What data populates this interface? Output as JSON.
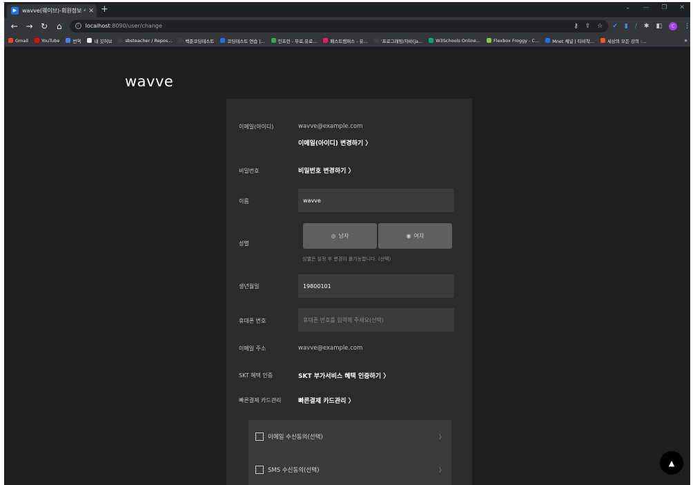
{
  "browser": {
    "tab_title": "wavve(웨이브)-회원정보 수정",
    "tab_close": "×",
    "new_tab": "+",
    "url_host": "localhost",
    "url_path": ":8090/user/change",
    "bookmarks": [
      {
        "label": "Gmail",
        "color": "#ea4335"
      },
      {
        "label": "YouTube",
        "color": "#ff0000"
      },
      {
        "label": "번역",
        "color": "#4285f4"
      },
      {
        "label": "내 깃허브",
        "color": "#e8eaed"
      },
      {
        "label": "sbsteacher / Repos...",
        "color": "#3c4043"
      },
      {
        "label": "백준코딩테스트",
        "color": "#3c4043"
      },
      {
        "label": "코딩테스트 연습 |...",
        "color": "#1a73e8"
      },
      {
        "label": "인프런 - 무료,유료...",
        "color": "#34a853"
      },
      {
        "label": "패스트캠퍼스 - 유...",
        "color": "#e91e63"
      },
      {
        "label": "'프로그래밍/자바(ja...",
        "color": "#3c4043"
      },
      {
        "label": "W3Schools Online...",
        "color": "#04aa6d"
      },
      {
        "label": "Flexbox Froggy - C...",
        "color": "#8bc34a"
      },
      {
        "label": "Mnet 채널 | 티비착...",
        "color": "#1a73e8"
      },
      {
        "label": "세상의 모든 강의 :...",
        "color": "#ff5722"
      }
    ],
    "bookmarks_more": "»",
    "profile_initial": "C"
  },
  "page": {
    "logo": "wavve",
    "email_id_label": "이메일(아이디)",
    "email_id_value": "wavve@example.com",
    "email_change_link": "이메일(아이디) 변경하기 〉",
    "password_label": "비밀번호",
    "password_change_link": "비밀번호 변경하기 〉",
    "name_label": "이름",
    "name_value": "wavve",
    "gender_label": "성별",
    "gender_male": "남자",
    "gender_female": "여자",
    "gender_hint": "성별은 설정 후 변경이 불가능합니다. (선택)",
    "birth_label": "생년월일",
    "birth_value": "19800101",
    "phone_label": "휴대폰 번호",
    "phone_placeholder": "휴대폰 번호를 입력해 주세요(선택)",
    "email_addr_label": "이메일 주소",
    "email_addr_value": "wavve@example.com",
    "skt_label": "SKT 혜택 인증",
    "skt_link": "SKT 부가서비스 혜택 인증하기 〉",
    "card_label": "빠른결제 카드관리",
    "card_link": "빠른결제 카드관리 〉",
    "consent_email": "이메일 수신동의(선택)",
    "consent_sms": "SMS 수신동의(선택)",
    "consent_chevron": "〉"
  }
}
